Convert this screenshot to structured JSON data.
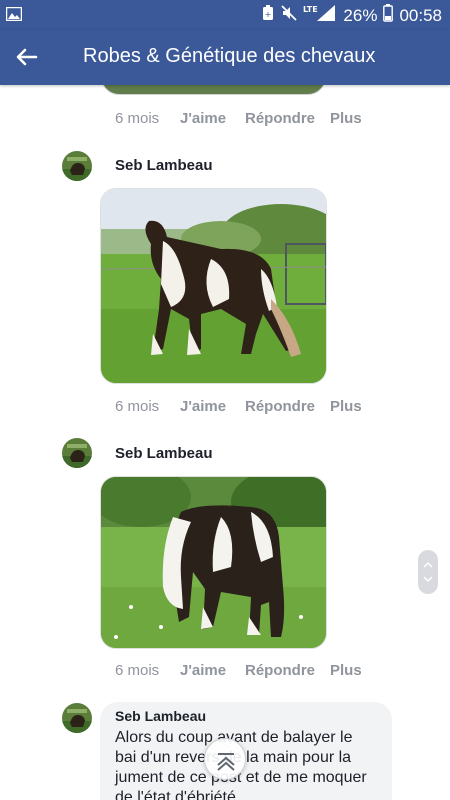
{
  "status_bar": {
    "network": "LTE",
    "battery_percent": "26%",
    "time": "00:58"
  },
  "app_bar": {
    "title": "Robes & Génétique des chevaux"
  },
  "comments": [
    {
      "actions": {
        "time": "6 mois",
        "like": "J'aime",
        "reply": "Répondre",
        "more": "Plus"
      }
    },
    {
      "author": "Seb Lambeau",
      "photo": "horse-image",
      "actions": {
        "time": "6 mois",
        "like": "J'aime",
        "reply": "Répondre",
        "more": "Plus"
      }
    },
    {
      "author": "Seb Lambeau",
      "photo": "horse-image",
      "actions": {
        "time": "6 mois",
        "like": "J'aime",
        "reply": "Répondre",
        "more": "Plus"
      }
    },
    {
      "author": "Seb Lambeau",
      "text": "Alors du coup avant de balayer le bai d'un revers de la main pour la jument de ce post et de me moquer de l'état d'ébriété"
    }
  ],
  "colors": {
    "brand": "#3b5998",
    "muted": "#90949c",
    "bubble": "#f2f3f5"
  }
}
